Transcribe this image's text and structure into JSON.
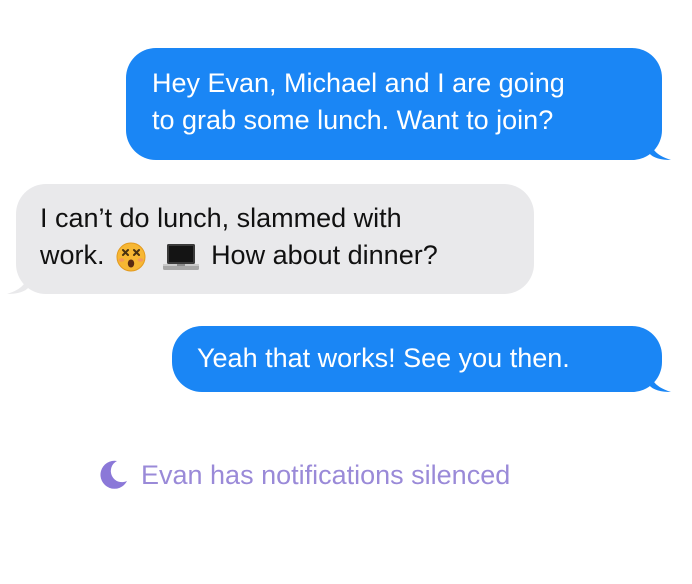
{
  "conversation": {
    "messages": [
      {
        "direction": "outgoing",
        "line1": "Hey Evan, Michael and I are going",
        "line2": "to grab some lunch. Want to join?"
      },
      {
        "direction": "incoming",
        "line1": "I can’t do lunch, slammed with",
        "line2_before": "work.",
        "line2_after": "How about dinner?",
        "emoji_names": [
          "dizzy-face-icon",
          "laptop-icon"
        ]
      },
      {
        "direction": "outgoing",
        "line1": "Yeah that works! See you then."
      }
    ],
    "status": {
      "icon": "moon-icon",
      "text": "Evan has notifications silenced"
    }
  },
  "colors": {
    "outgoing_bubble": "#1a86f5",
    "incoming_bubble": "#e9e9eb",
    "status_text": "#9a8ad8"
  }
}
